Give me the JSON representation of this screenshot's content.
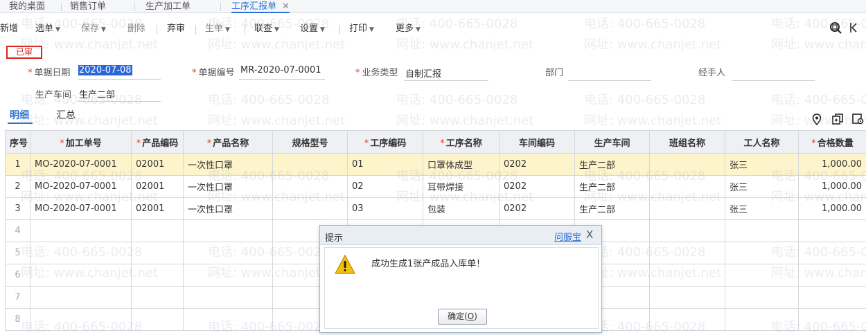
{
  "tabs": [
    {
      "label": "我的桌面"
    },
    {
      "label": "销售订单"
    },
    {
      "label": "生产加工单"
    },
    {
      "label": "工序汇报单",
      "close": "✕"
    }
  ],
  "toolbar": {
    "new": "新增",
    "select": "选单",
    "save": "保存",
    "delete": "删除",
    "abandon": "弃审",
    "generate": "生单",
    "query": "联查",
    "settings": "设置",
    "print": "打印",
    "more": "更多",
    "chevron": "▼"
  },
  "status_badge": "已审",
  "form": {
    "date_label": "单据日期",
    "date_value": "2020-07-08",
    "number_label": "单据编号",
    "number_value": "MR-2020-07-0001",
    "biztype_label": "业务类型",
    "biztype_value": "自制汇报",
    "dept_label": "部门",
    "dept_value": "",
    "handler_label": "经手人",
    "handler_value": "",
    "workshop_label": "生产车间",
    "workshop_value": "生产二部"
  },
  "subtabs": [
    {
      "label": "明细"
    },
    {
      "label": "汇总"
    }
  ],
  "table": {
    "headers": [
      {
        "label": "序号",
        "required": false
      },
      {
        "label": "加工单号",
        "required": true
      },
      {
        "label": "产品编码",
        "required": true
      },
      {
        "label": "产品名称",
        "required": true
      },
      {
        "label": "规格型号",
        "required": false
      },
      {
        "label": "工序编码",
        "required": true
      },
      {
        "label": "工序名称",
        "required": true
      },
      {
        "label": "车间编码",
        "required": false
      },
      {
        "label": "生产车间",
        "required": false
      },
      {
        "label": "班组名称",
        "required": false
      },
      {
        "label": "工人名称",
        "required": false
      },
      {
        "label": "合格数量",
        "required": true
      }
    ],
    "required_mark": "*",
    "rows": [
      [
        "1",
        "MO-2020-07-0001",
        "02001",
        "一次性口罩",
        "",
        "01",
        "口罩体成型",
        "0202",
        "生产二部",
        "",
        "张三",
        "1,000.00"
      ],
      [
        "2",
        "MO-2020-07-0001",
        "02001",
        "一次性口罩",
        "",
        "02",
        "耳带焊接",
        "0202",
        "生产二部",
        "",
        "张三",
        "1,000.00"
      ],
      [
        "3",
        "MO-2020-07-0001",
        "02001",
        "一次性口罩",
        "",
        "03",
        "包装",
        "0202",
        "生产二部",
        "",
        "张三",
        "1,000.00"
      ]
    ],
    "empty_rows": [
      "4",
      "5",
      "6",
      "7",
      "8"
    ]
  },
  "watermark": {
    "phone": "电话: 400-665-0028",
    "site": "网址: www.chanjet.net"
  },
  "dialog": {
    "title": "提示",
    "link": "问服宝",
    "close": "X",
    "message": "成功生成1张产成品入库单！",
    "ok_text": "确定(",
    "ok_key": "O",
    "ok_end": ")"
  },
  "icons": {
    "toolbar_right": [
      "search-zoom-icon",
      "collapse-icon"
    ],
    "grid_right": [
      "location-pin-icon",
      "copy-row-icon",
      "settings-icon"
    ],
    "dialog": "warning-icon"
  },
  "colors": {
    "accent": "#2b6fd6",
    "status": "#d9251c",
    "required": "#e0402a",
    "selected_row": "#fdf4cc",
    "warning": "#f4c20d"
  }
}
